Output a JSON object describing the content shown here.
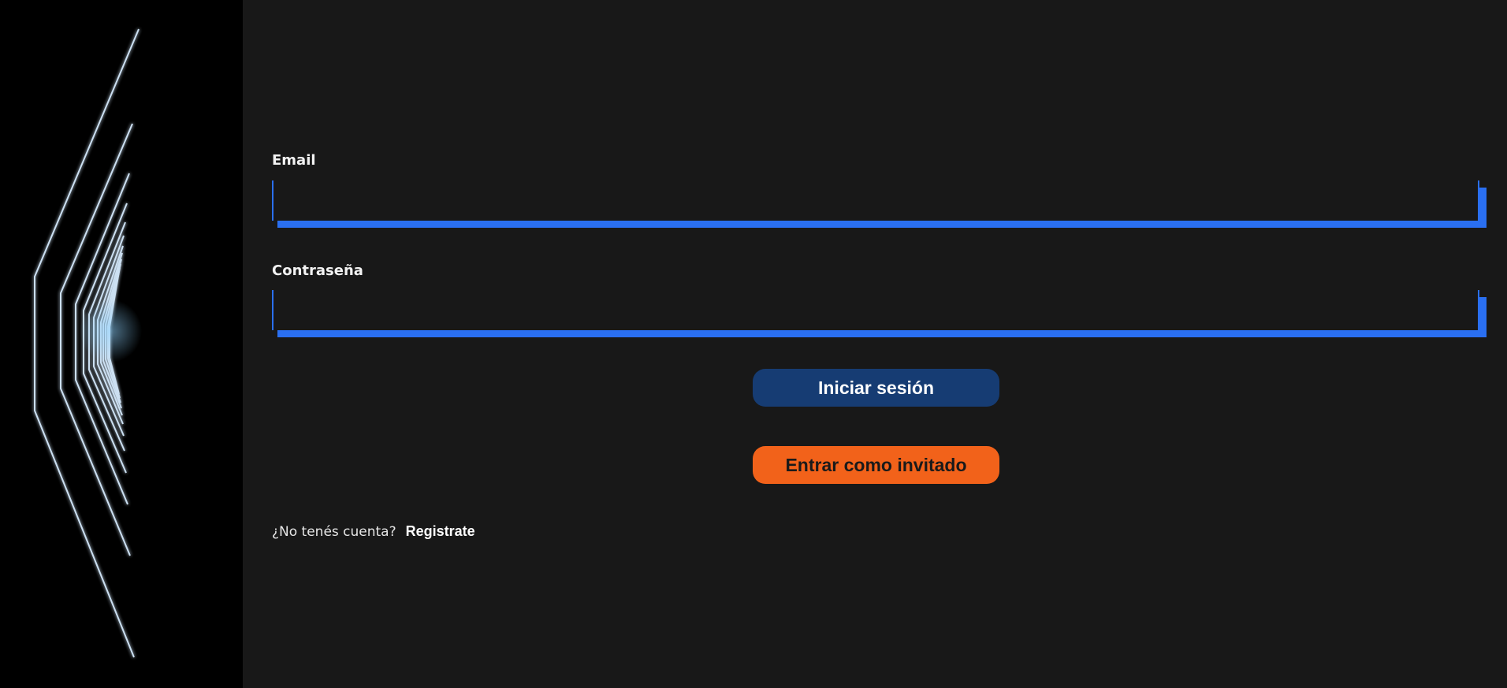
{
  "colors": {
    "background": "#181818",
    "side_panel": "#000000",
    "field_accent": "#2a6ff1",
    "login_button": "#163c73",
    "guest_button": "#f2621a"
  },
  "side_panel": {
    "image": "neon-tunnel-lines-illustration"
  },
  "form": {
    "email": {
      "label": "Email",
      "value": "",
      "placeholder": ""
    },
    "password": {
      "label": "Contraseña",
      "value": "",
      "placeholder": ""
    },
    "login_button": "Iniciar sesión",
    "guest_button": "Entrar como invitado",
    "register_prompt": "¿No tenés cuenta?",
    "register_link": "Registrate"
  }
}
